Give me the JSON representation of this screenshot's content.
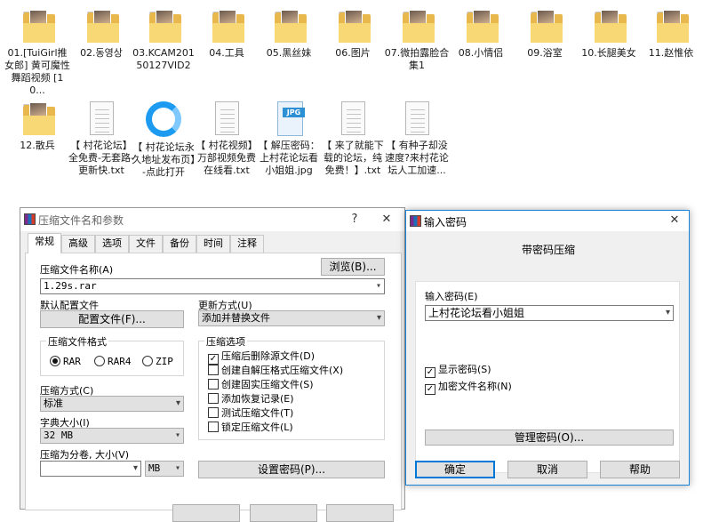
{
  "desktop": {
    "files": [
      {
        "name": "01.[TuiGirl推女郎] 黄可魔性舞蹈视频 [10...",
        "type": "folder"
      },
      {
        "name": "02.동영상",
        "type": "folder"
      },
      {
        "name": "03.KCAM20150127VID2",
        "type": "folder"
      },
      {
        "name": "04.工具",
        "type": "folder"
      },
      {
        "name": "05.黑丝妹",
        "type": "folder"
      },
      {
        "name": "06.图片",
        "type": "folder"
      },
      {
        "name": "07.微拍露脸合集1",
        "type": "folder"
      },
      {
        "name": "08.小情侣",
        "type": "folder"
      },
      {
        "name": "09.浴室",
        "type": "folder"
      },
      {
        "name": "10.长腿美女",
        "type": "folder"
      },
      {
        "name": "11.赵惟依",
        "type": "folder"
      },
      {
        "name": "12.散兵",
        "type": "folder"
      },
      {
        "name": "【 村花论坛】全免费-无套路-更新快.txt",
        "type": "txt"
      },
      {
        "name": "【 村花论坛永久地址发布页】-点此打开",
        "type": "qq"
      },
      {
        "name": "【 村花视频】万部视频免费在线看.txt",
        "type": "txt"
      },
      {
        "name": "【 解压密码：上村花论坛看小姐姐.jpg",
        "type": "jpg"
      },
      {
        "name": "【 来了就能下载的论坛，纯免费！】.txt",
        "type": "txt"
      },
      {
        "name": "【 有种子却没速度?来村花论坛人工加速...",
        "type": "txt"
      }
    ],
    "jpg_tag": "JPG"
  },
  "archive_dialog": {
    "title": "压缩文件名和参数",
    "help_glyph": "?",
    "close_glyph": "✕",
    "tabs": [
      "常规",
      "高级",
      "选项",
      "文件",
      "备份",
      "时间",
      "注释"
    ],
    "filename_label": "压缩文件名称(A)",
    "browse_button": "浏览(B)...",
    "filename_value": "1.29s.rar",
    "default_config_label": "默认配置文件",
    "config_button": "配置文件(F)...",
    "update_mode_label": "更新方式(U)",
    "update_mode_value": "添加并替换文件",
    "format_group": "压缩文件格式",
    "formats": [
      "RAR",
      "RAR4",
      "ZIP"
    ],
    "method_label": "压缩方式(C)",
    "method_value": "标准",
    "dict_label": "字典大小(I)",
    "dict_value": "32 MB",
    "split_label": "压缩为分卷, 大小(V)",
    "split_value": "",
    "split_unit": "MB",
    "options_group": "压缩选项",
    "options": [
      {
        "label": "压缩后删除源文件(D)",
        "checked": true
      },
      {
        "label": "创建自解压格式压缩文件(X)",
        "checked": false
      },
      {
        "label": "创建固实压缩文件(S)",
        "checked": false
      },
      {
        "label": "添加恢复记录(E)",
        "checked": false
      },
      {
        "label": "测试压缩文件(T)",
        "checked": false
      },
      {
        "label": "锁定压缩文件(L)",
        "checked": false
      }
    ],
    "set_password_button": "设置密码(P)..."
  },
  "password_dialog": {
    "title": "输入密码",
    "close_glyph": "✕",
    "heading": "带密码压缩",
    "password_label": "输入密码(E)",
    "password_value": "上村花论坛看小姐姐",
    "show_password": {
      "label": "显示密码(S)",
      "checked": true
    },
    "encrypt_names": {
      "label": "加密文件名称(N)",
      "checked": true
    },
    "manage_button": "管理密码(O)...",
    "ok_button": "确定",
    "cancel_button": "取消",
    "help_button": "帮助"
  }
}
